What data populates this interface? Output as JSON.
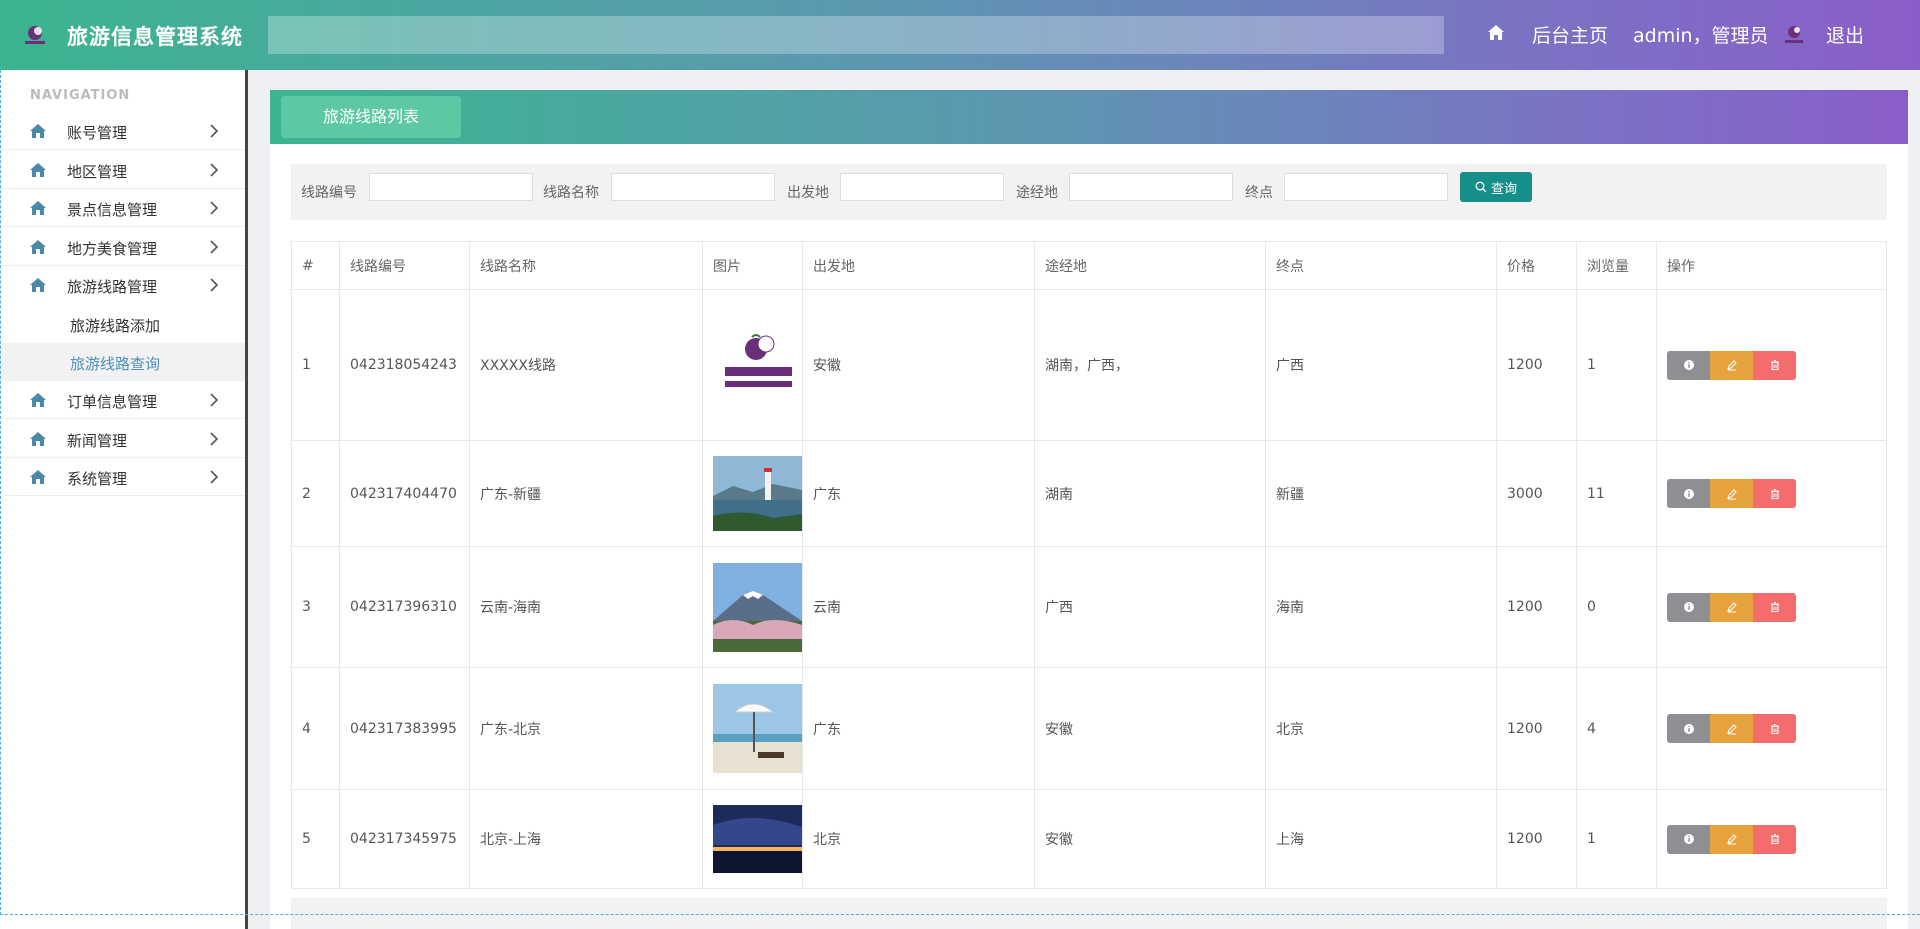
{
  "header": {
    "title": "旅游信息管理系统",
    "home_label": "后台主页",
    "user_label": "admin，管理员",
    "logout_label": "退出"
  },
  "sidebar": {
    "caption": "NAVIGATION",
    "items": [
      {
        "label": "账号管理"
      },
      {
        "label": "地区管理"
      },
      {
        "label": "景点信息管理"
      },
      {
        "label": "地方美食管理"
      },
      {
        "label": "旅游线路管理"
      },
      {
        "label": "订单信息管理"
      },
      {
        "label": "新闻管理"
      },
      {
        "label": "系统管理"
      }
    ],
    "subitems": [
      {
        "label": "旅游线路添加"
      },
      {
        "label": "旅游线路查询",
        "active": true
      }
    ]
  },
  "panel": {
    "tab_label": "旅游线路列表"
  },
  "search": {
    "route_no_label": "线路编号",
    "route_name_label": "线路名称",
    "origin_label": "出发地",
    "via_label": "途经地",
    "dest_label": "终点",
    "button_label": "查询"
  },
  "table": {
    "columns": [
      "#",
      "线路编号",
      "线路名称",
      "图片",
      "出发地",
      "途经地",
      "终点",
      "价格",
      "浏览量",
      "操作"
    ],
    "rows": [
      {
        "idx": "1",
        "code": "042318054243",
        "name": "XXXXX线路",
        "image": "杭州水果 HZFRUI logo",
        "origin": "安徽",
        "via": "湖南，广西，",
        "dest": "广西",
        "price": "1200",
        "views": "1"
      },
      {
        "idx": "2",
        "code": "042317404470",
        "name": "广东-新疆",
        "image": "lighthouse-seascape",
        "origin": "广东",
        "via": "湖南",
        "dest": "新疆",
        "price": "3000",
        "views": "11"
      },
      {
        "idx": "3",
        "code": "042317396310",
        "name": "云南-海南",
        "image": "mount-fuji-blossoms",
        "origin": "云南",
        "via": "广西",
        "dest": "海南",
        "price": "1200",
        "views": "0"
      },
      {
        "idx": "4",
        "code": "042317383995",
        "name": "广东-北京",
        "image": "beach-umbrella",
        "origin": "广东",
        "via": "安徽",
        "dest": "北京",
        "price": "1200",
        "views": "4"
      },
      {
        "idx": "5",
        "code": "042317345975",
        "name": "北京-上海",
        "image": "night-city-lake",
        "origin": "北京",
        "via": "安徽",
        "dest": "上海",
        "price": "1200",
        "views": "1"
      }
    ]
  },
  "icons": {
    "home": "home-icon",
    "nav": "house-icon",
    "chevron": "chevron-right-icon",
    "search": "search-icon",
    "info": "info-icon",
    "edit": "pencil-icon",
    "delete": "trash-icon"
  },
  "colors": {
    "header_start": "#3bb58f",
    "header_end": "#8a5ec9",
    "tab": "#5cc9a4",
    "search_button": "#168f8a",
    "info_button": "#8e8e93",
    "edit_button": "#e6a23c",
    "delete_button": "#f56c6c",
    "active_nav": "#4a90b8"
  }
}
